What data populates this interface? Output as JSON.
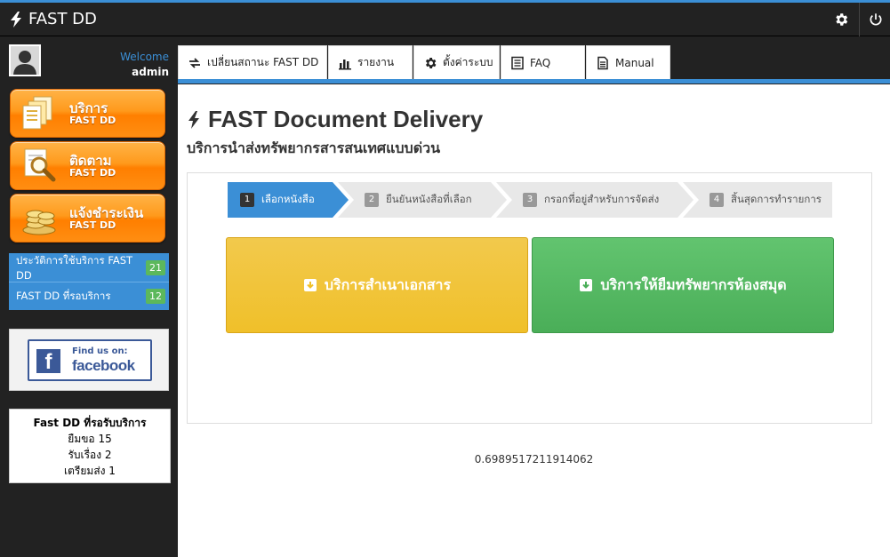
{
  "app": {
    "title": "FAST DD"
  },
  "user": {
    "welcome": "Welcome",
    "name": "admin"
  },
  "sidebar": {
    "menu": [
      {
        "label": "บริการ",
        "sub": "FAST DD",
        "icon": "documents-icon"
      },
      {
        "label": "ติดตาม",
        "sub": "FAST DD",
        "icon": "magnifier-icon"
      },
      {
        "label": "แจ้งชำระเงิน",
        "sub": "FAST DD",
        "icon": "coins-icon"
      }
    ],
    "list": [
      {
        "label": "ประวัติการใช้บริการ FAST DD",
        "count": "21"
      },
      {
        "label": "FAST DD ที่รอบริการ",
        "count": "12"
      }
    ],
    "facebook": {
      "find": "Find us on:",
      "name": "facebook"
    },
    "status": {
      "title": "Fast DD ที่รอรับบริการ",
      "lines": [
        "ยืมขอ 15",
        "รับเรื่อง 2",
        "เตรียมส่ง 1"
      ]
    }
  },
  "tabs": [
    {
      "label": "เปลี่ยนสถานะ FAST DD",
      "icon": "exchange-icon"
    },
    {
      "label": "รายงาน",
      "icon": "bar-chart-icon"
    },
    {
      "label": "ตั้งค่าระบบ",
      "icon": "gear-icon"
    },
    {
      "label": "FAQ",
      "icon": "list-icon"
    },
    {
      "label": "Manual",
      "icon": "document-icon"
    }
  ],
  "page": {
    "title": "FAST Document Delivery",
    "subtitle": "บริการนำส่งทรัพยากรสารสนเทศแบบด่วน"
  },
  "wizard": [
    {
      "num": "1",
      "label": "เลือกหนังสือ",
      "active": true
    },
    {
      "num": "2",
      "label": "ยืนยันหนังสือที่เลือก",
      "active": false
    },
    {
      "num": "3",
      "label": "กรอกที่อยู่สำหรับการจัดส่ง",
      "active": false
    },
    {
      "num": "4",
      "label": "สิ้นสุดการทำรายการ",
      "active": false
    }
  ],
  "actions": {
    "copy": "บริการสำเนาเอกสาร",
    "loan": "บริการให้ยืมทรัพยากรห้องสมุด"
  },
  "footer": {
    "value": "0.6989517211914062"
  },
  "colors": {
    "accent": "#3b8fd6",
    "orange": "#ff8e12",
    "yellow": "#f0c02a",
    "green": "#4aae58"
  }
}
